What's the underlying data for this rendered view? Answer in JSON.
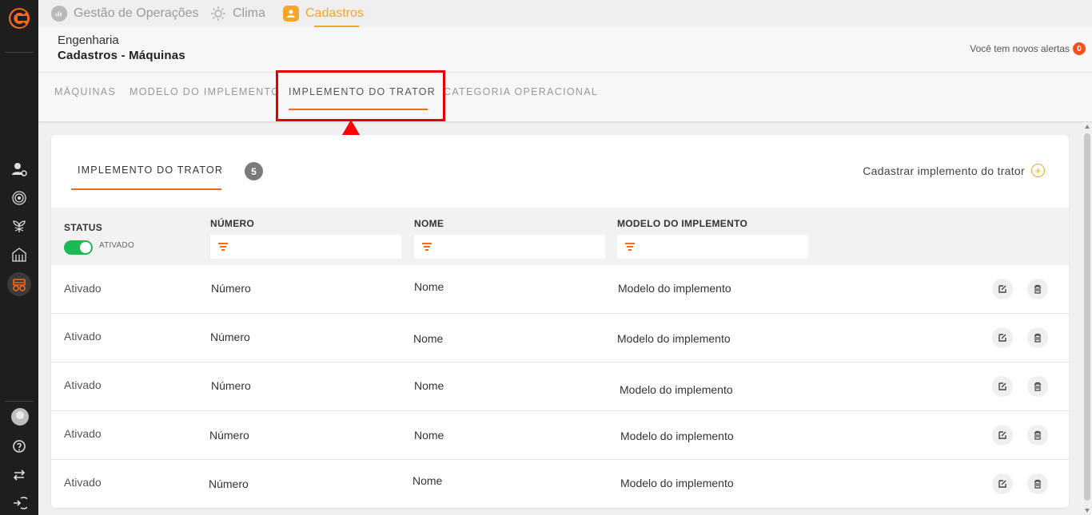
{
  "topnav": {
    "items": [
      {
        "label": "Gestão de Operações",
        "icon": "chart-icon"
      },
      {
        "label": "Clima",
        "icon": "sun-icon"
      },
      {
        "label": "Cadastros",
        "icon": "user-icon"
      }
    ],
    "active_color": "#f4a62a"
  },
  "header": {
    "breadcrumb_parent": "Engenharia",
    "page_title": "Cadastros - Máquinas",
    "alerts_label": "Você tem novos alertas",
    "alerts_count": "0"
  },
  "subtabs": {
    "items": [
      "MÁQUINAS",
      "MODELO DO IMPLEMENTO",
      "IMPLEMENTO DO TRATOR",
      "CATEGORIA OPERACIONAL"
    ],
    "active_index": 2
  },
  "card": {
    "title": "IMPLEMENTO DO TRATOR",
    "count": "5",
    "add_label": "Cadastrar implemento do trator"
  },
  "table": {
    "columns": {
      "status": "STATUS",
      "numero": "NÚMERO",
      "nome": "NOME",
      "modelo": "MODELO DO IMPLEMENTO"
    },
    "status_toggle_label": "ATIVADO",
    "rows": [
      {
        "status": "Ativado",
        "numero": "Número",
        "nome": "Nome",
        "modelo": "Modelo do implemento"
      },
      {
        "status": "Ativado",
        "numero": "Número",
        "nome": "Nome",
        "modelo": "Modelo do implemento"
      },
      {
        "status": "Ativado",
        "numero": "Número",
        "nome": "Nome",
        "modelo": "Modelo do implemento"
      },
      {
        "status": "Ativado",
        "numero": "Número",
        "nome": "Nome",
        "modelo": "Modelo do implemento"
      },
      {
        "status": "Ativado",
        "numero": "Número",
        "nome": "Nome",
        "modelo": "Modelo do implemento"
      }
    ]
  },
  "colors": {
    "accent_orange": "#f26b1d",
    "toggle_green": "#1db954",
    "highlight_red": "#e50000"
  }
}
